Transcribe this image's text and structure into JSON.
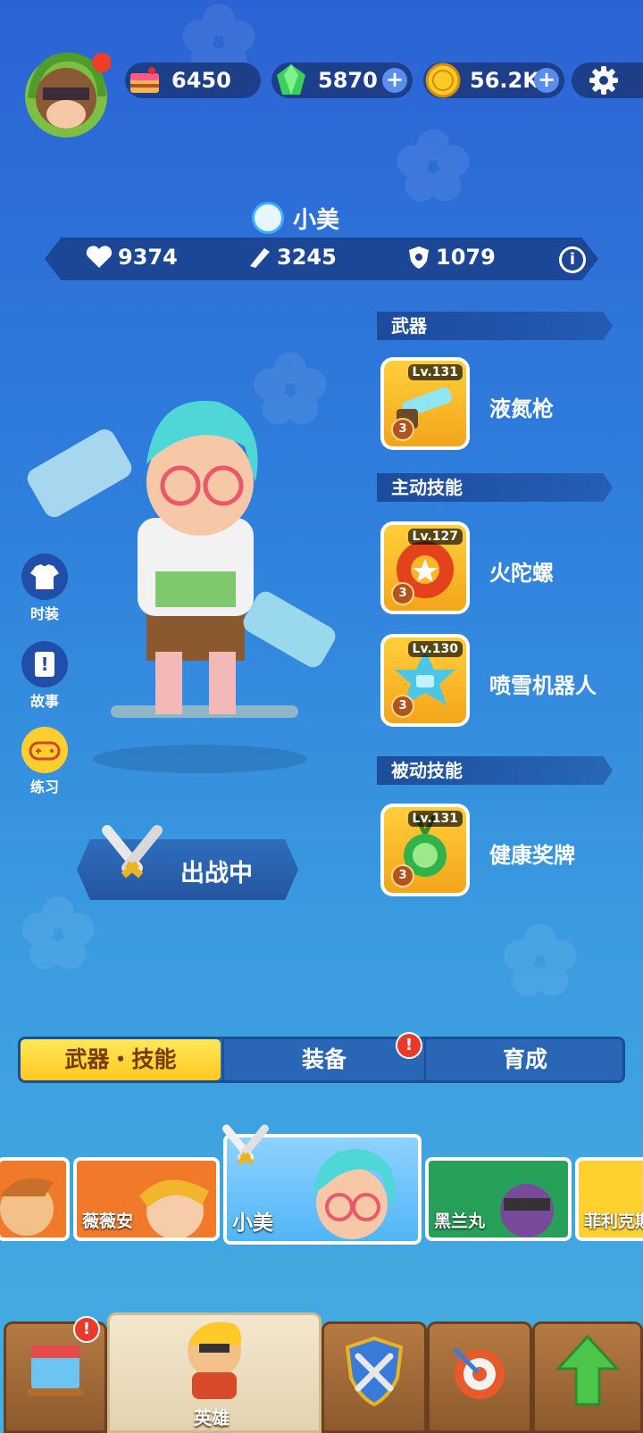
{
  "resources": {
    "cake": "6450",
    "gems": "5870",
    "coins": "56.2K"
  },
  "hero": {
    "name": "小美",
    "stats": {
      "hp": "9374",
      "attack": "3245",
      "defense": "1079"
    }
  },
  "sections": {
    "weapon": "武器",
    "active": "主动技能",
    "passive": "被动技能"
  },
  "skills": [
    {
      "level": "Lv.131",
      "rank": "3",
      "name": "液氮枪"
    },
    {
      "level": "Lv.127",
      "rank": "3",
      "name": "火陀螺"
    },
    {
      "level": "Lv.130",
      "rank": "3",
      "name": "喷雪机器人"
    },
    {
      "level": "Lv.131",
      "rank": "3",
      "name": "健康奖牌"
    }
  ],
  "side_menu": [
    "时装",
    "故事",
    "练习"
  ],
  "deploy_label": "出战中",
  "tabs": [
    "武器・技能",
    "装备",
    "育成"
  ],
  "roster": [
    "薇薇安",
    "小美",
    "黑兰丸",
    "菲利克斯"
  ],
  "bottom_nav": {
    "hero_label": "英雄"
  },
  "alerts": {
    "equip": "!",
    "shop": "!"
  },
  "colors": {
    "accent_yellow": "#ffd12e",
    "panel_blue": "#1d3f8a",
    "alert_red": "#e83a2a"
  }
}
